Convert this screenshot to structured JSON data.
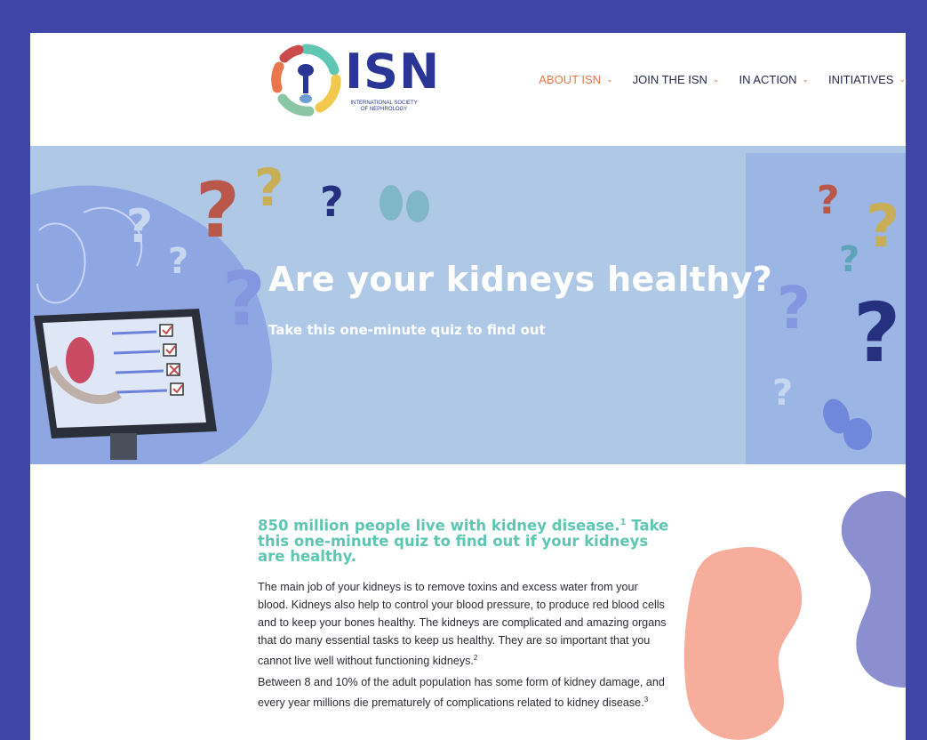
{
  "logo": {
    "name": "ISN",
    "subtitle_line1": "INTERNATIONAL SOCIETY",
    "subtitle_line2": "OF NEPHROLOGY"
  },
  "nav": {
    "items": [
      {
        "label": "ABOUT ISN",
        "active": true
      },
      {
        "label": "JOIN THE ISN",
        "active": false
      },
      {
        "label": "IN ACTION",
        "active": false
      },
      {
        "label": "INITIATIVES",
        "active": false
      }
    ],
    "chevron_icon": "chevron-down-icon"
  },
  "hero": {
    "title": "Are your kidneys healthy?",
    "subtitle": "Take this one-minute quiz to find out"
  },
  "content": {
    "heading": "850 million people live with kidney disease.",
    "heading_ref": "1",
    "heading_rest": " Take this one-minute quiz to find out if your kidneys are healthy.",
    "paragraph1": "The main job of your kidneys is to remove toxins and excess water from your blood. Kidneys also help to control your blood pressure, to produce red blood cells and to keep your bones healthy. The kidneys are complicated and amazing organs that do many essential tasks to keep us healthy. They are so important that you cannot live well without functioning kidneys.",
    "paragraph1_ref": "2",
    "paragraph2": "Between 8 and 10% of the adult population has some form of kidney damage, and every year millions die prematurely of complications related to kidney disease.",
    "paragraph2_ref": "3"
  },
  "colors": {
    "frame": "#3f46a8",
    "accent_orange": "#e8774e",
    "teal_heading": "#5ec6b2",
    "hero_bg": "#aec8e6",
    "hero_band": "#9bb5e4",
    "logo_blue": "#2a3696"
  }
}
